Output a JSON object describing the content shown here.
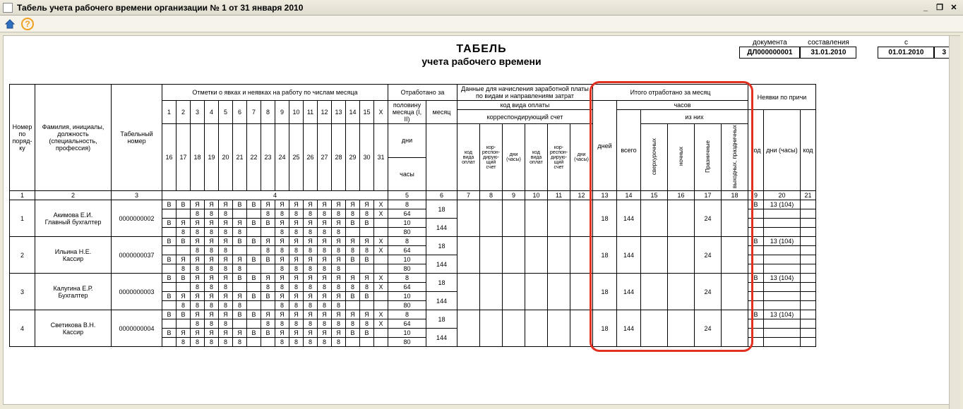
{
  "window_title": "Табель учета рабочего времени организации № 1 от 31 января 2010",
  "title": "ТАБЕЛЬ",
  "subtitle": "учета  рабочего времени",
  "header_boxes": {
    "doc_label": "документа",
    "doc_value": "ДЛ000000001",
    "comp_label": "составления",
    "comp_value": "31.01.2010",
    "period_label": "с",
    "period_from": "01.01.2010",
    "period_to": "3"
  },
  "col_headers": {
    "num": "Номер по поряд-ку",
    "fio": "Фамилия, инициалы, должность (специальность, профессия)",
    "tabnum": "Табельный номер",
    "marks": "Отметки о явках и неявках на работу по числам месяца",
    "worked": "Отработано за",
    "half_month": "половину месяца (I, II)",
    "month": "месяц",
    "days": "дни",
    "hours": "часы",
    "payroll": "Данные для начисления заработной платы по видам и направлениям затрат",
    "pay_code": "код вида оплаты",
    "corr_acc": "корреспондирующий счет",
    "pay_sub1": "код вида оплат",
    "pay_sub2": "кор-респон-дирую-щий счет",
    "pay_sub3": "дни (часы)",
    "month_total": "Итого отработано за месяц",
    "mt_hours": "часов",
    "mt_of": "из них",
    "mt_days": "дней",
    "mt_total": "всего",
    "mt_over": "сверхурочных",
    "mt_night": "ночных",
    "mt_holiday": "Празничные",
    "mt_weekend": "выходных, праздничных",
    "absence": "Неявки по причи",
    "abs_code": "код",
    "abs_days": "дни (часы)",
    "abs_code2": "код"
  },
  "half1_days": [
    "1",
    "2",
    "3",
    "4",
    "5",
    "6",
    "7",
    "8",
    "9",
    "10",
    "11",
    "12",
    "13",
    "14",
    "15",
    "X"
  ],
  "half2_days": [
    "16",
    "17",
    "18",
    "19",
    "20",
    "21",
    "22",
    "23",
    "24",
    "25",
    "26",
    "27",
    "28",
    "29",
    "30",
    "31"
  ],
  "colnum_row": [
    "1",
    "2",
    "3",
    "4",
    "5",
    "6",
    "7",
    "8",
    "9",
    "10",
    "11",
    "12",
    "13",
    "14",
    "15",
    "16",
    "17",
    "18",
    "9",
    "20",
    "21"
  ],
  "employees": [
    {
      "num": "1",
      "fio": "Акимова Е.И., Главный бухгалтер",
      "tab": "0000000002",
      "rows": {
        "h1_codes": [
          "В",
          "В",
          "Я",
          "Я",
          "Я",
          "В",
          "В",
          "Я",
          "Я",
          "Я",
          "Я",
          "Я",
          "Я",
          "Я",
          "Я",
          "X"
        ],
        "h1_hrs": [
          "",
          "",
          "8",
          "8",
          "8",
          "",
          "",
          "8",
          "8",
          "8",
          "8",
          "8",
          "8",
          "8",
          "8",
          "X"
        ],
        "h2_codes": [
          "В",
          "Я",
          "Я",
          "Я",
          "Я",
          "Я",
          "В",
          "В",
          "Я",
          "Я",
          "Я",
          "Я",
          "Я",
          "В",
          "В",
          ""
        ],
        "h2_hrs": [
          "",
          "8",
          "8",
          "8",
          "8",
          "8",
          "",
          "",
          "8",
          "8",
          "8",
          "8",
          "8",
          "",
          "",
          ""
        ]
      },
      "half_days": "8",
      "half_hours": "64",
      "half2_days": "10",
      "half2_hours": "80",
      "month_days": "18",
      "month_hours": "144",
      "tot_days": "18",
      "tot_hours": "144",
      "holiday": "24",
      "abs_code": "В",
      "abs_val": "13 (104)"
    },
    {
      "num": "2",
      "fio": "Ильина Н.Е., Кассир",
      "tab": "0000000037",
      "rows": {
        "h1_codes": [
          "В",
          "В",
          "Я",
          "Я",
          "Я",
          "В",
          "В",
          "Я",
          "Я",
          "Я",
          "Я",
          "Я",
          "Я",
          "Я",
          "Я",
          "X"
        ],
        "h1_hrs": [
          "",
          "",
          "8",
          "8",
          "8",
          "",
          "",
          "8",
          "8",
          "8",
          "8",
          "8",
          "8",
          "8",
          "8",
          "X"
        ],
        "h2_codes": [
          "В",
          "Я",
          "Я",
          "Я",
          "Я",
          "Я",
          "В",
          "В",
          "Я",
          "Я",
          "Я",
          "Я",
          "Я",
          "В",
          "В",
          ""
        ],
        "h2_hrs": [
          "",
          "8",
          "8",
          "8",
          "8",
          "8",
          "",
          "",
          "8",
          "8",
          "8",
          "8",
          "8",
          "",
          "",
          ""
        ]
      },
      "half_days": "8",
      "half_hours": "64",
      "half2_days": "10",
      "half2_hours": "80",
      "month_days": "18",
      "month_hours": "144",
      "tot_days": "18",
      "tot_hours": "144",
      "holiday": "24",
      "abs_code": "В",
      "abs_val": "13 (104)"
    },
    {
      "num": "3",
      "fio": "Калугина Е.Р., Бухгалтер",
      "tab": "0000000003",
      "rows": {
        "h1_codes": [
          "В",
          "В",
          "Я",
          "Я",
          "Я",
          "В",
          "В",
          "Я",
          "Я",
          "Я",
          "Я",
          "Я",
          "Я",
          "Я",
          "Я",
          "X"
        ],
        "h1_hrs": [
          "",
          "",
          "8",
          "8",
          "8",
          "",
          "",
          "8",
          "8",
          "8",
          "8",
          "8",
          "8",
          "8",
          "8",
          "X"
        ],
        "h2_codes": [
          "В",
          "Я",
          "Я",
          "Я",
          "Я",
          "Я",
          "В",
          "В",
          "Я",
          "Я",
          "Я",
          "Я",
          "Я",
          "В",
          "В",
          ""
        ],
        "h2_hrs": [
          "",
          "8",
          "8",
          "8",
          "8",
          "8",
          "",
          "",
          "8",
          "8",
          "8",
          "8",
          "8",
          "",
          "",
          ""
        ]
      },
      "half_days": "8",
      "half_hours": "64",
      "half2_days": "10",
      "half2_hours": "80",
      "month_days": "18",
      "month_hours": "144",
      "tot_days": "18",
      "tot_hours": "144",
      "holiday": "24",
      "abs_code": "В",
      "abs_val": "13 (104)"
    },
    {
      "num": "4",
      "fio": "Светикова В.Н., Кассир",
      "tab": "0000000004",
      "rows": {
        "h1_codes": [
          "В",
          "В",
          "Я",
          "Я",
          "Я",
          "В",
          "В",
          "Я",
          "Я",
          "Я",
          "Я",
          "Я",
          "Я",
          "Я",
          "Я",
          "X"
        ],
        "h1_hrs": [
          "",
          "",
          "8",
          "8",
          "8",
          "",
          "",
          "8",
          "8",
          "8",
          "8",
          "8",
          "8",
          "8",
          "8",
          "X"
        ],
        "h2_codes": [
          "В",
          "Я",
          "Я",
          "Я",
          "Я",
          "Я",
          "В",
          "В",
          "Я",
          "Я",
          "Я",
          "Я",
          "Я",
          "В",
          "В",
          ""
        ],
        "h2_hrs": [
          "",
          "8",
          "8",
          "8",
          "8",
          "8",
          "",
          "",
          "8",
          "8",
          "8",
          "8",
          "8",
          "",
          "",
          ""
        ]
      },
      "half_days": "8",
      "half_hours": "64",
      "half2_days": "10",
      "half2_hours": "80",
      "month_days": "18",
      "month_hours": "144",
      "tot_days": "18",
      "tot_hours": "144",
      "holiday": "24",
      "abs_code": "В",
      "abs_val": "13 (104)"
    }
  ]
}
